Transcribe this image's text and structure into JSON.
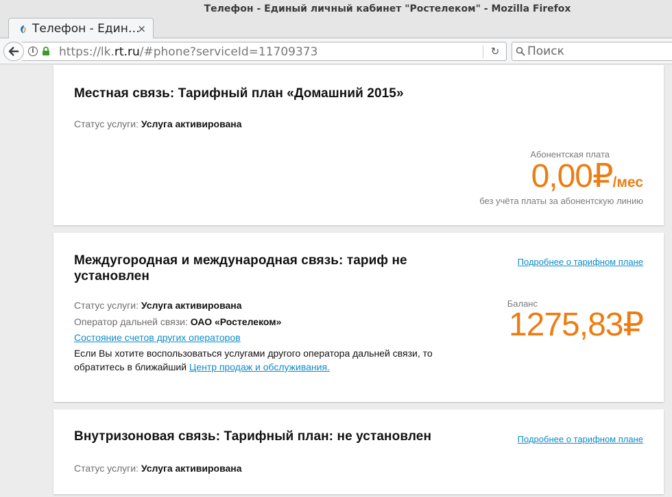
{
  "window": {
    "title": "Телефон - Единый личный кабинет \"Ростелеком\" - Mozilla Firefox"
  },
  "tab": {
    "label": "Телефон - Един…",
    "close": "×",
    "new_tab": "+"
  },
  "navbar": {
    "url_prefix": "https://lk.",
    "url_host": "rt.ru",
    "url_path": "/#phone?serviceId=11709373",
    "search_placeholder": "Поиск"
  },
  "cards": {
    "local": {
      "title": "Местная связь: Тарифный план «Домашний 2015»",
      "status_label": "Статус услуги:",
      "status_value": "Услуга активирована",
      "fee_label": "Абонентская плата",
      "fee_amount": "0,00₽",
      "fee_unit": "/мес",
      "fee_note": "без учёта платы за абонентскую линию"
    },
    "longdistance": {
      "title": "Междугородная и международная связь: тариф не установлен",
      "plan_link": "Подробнее о тарифном плане",
      "status_label": "Статус услуги:",
      "status_value": "Услуга активирована",
      "operator_label": "Оператор дальней связи:",
      "operator_value": "ОАО «Ростелеком»",
      "other_operators_link": "Состояние счетов других операторов",
      "note_text": "Если Вы хотите воспользоваться услугами другого оператора дальней связи, то обратитесь в ближайший",
      "note_link": "Центр продаж и обслуживания.",
      "balance_label": "Баланс",
      "balance_amount": "1275,83₽"
    },
    "intrazone": {
      "title": "Внутризоновая связь: Тарифный план: не установлен",
      "plan_link": "Подробнее о тарифном плане",
      "status_label": "Статус услуги:",
      "status_value": "Услуга активирована"
    }
  },
  "colors": {
    "accent_orange": "#ec7d12",
    "link_blue": "#0d8bc8"
  }
}
